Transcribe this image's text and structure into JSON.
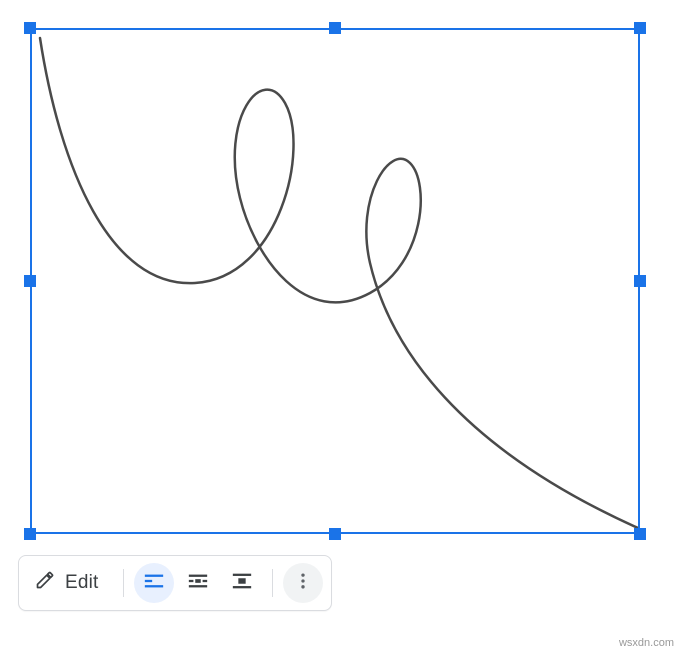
{
  "colors": {
    "selection": "#1a73e8",
    "stroke": "#4a4a4a"
  },
  "toolbar": {
    "edit_label": "Edit",
    "icons": {
      "pencil": "pencil-icon",
      "inline": "wrap-inline-icon",
      "wrap": "wrap-text-icon",
      "break": "break-text-icon",
      "more": "more-vert-icon"
    },
    "active_wrap": "inline"
  },
  "watermark": "wsxdn.com"
}
